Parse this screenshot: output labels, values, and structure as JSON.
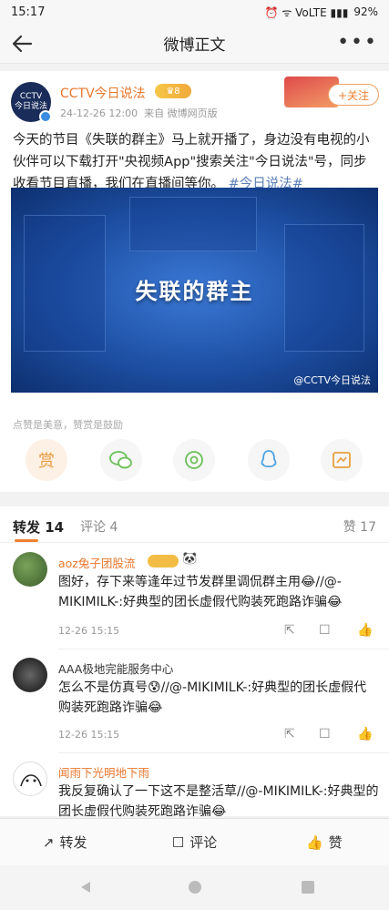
{
  "status_bar": {
    "time": "15:17",
    "icons_text": "⏰ ᯤ VoLTE ▮▮▮",
    "battery": "92%"
  },
  "nav": {
    "title": "微博正文"
  },
  "post": {
    "author": "CCTV今日说法",
    "avatar_text": "CCTV\n今日说法",
    "vip_label": "8",
    "time": "24-12-26 12:00",
    "source": "来自 微博网页版",
    "follow_label": "+关注",
    "text": "今天的节目《失联的群主》马上就开播了，身边没有电视的小伙伴可以下载打开\"央视频App\"搜索关注\"今日说法\"号，同步收看节目直播，我们在直播间等你。",
    "hashtag": "#今日说法#",
    "video_title": "失联的群主",
    "video_watermark": "@CCTV今日说法",
    "appreciation_hint": "点赞是美意，赞赏是鼓励",
    "share_icons": [
      "reward-icon",
      "wechat-icon",
      "moments-icon",
      "qq-icon",
      "save-image-icon"
    ],
    "reward_label": "赏"
  },
  "tabs": {
    "repost": "转发 14",
    "comment": "评论 4",
    "like": "赞 17"
  },
  "comments": [
    {
      "name": "aoz兔子团股流",
      "name_color": "#e8772d",
      "text": "图好，存下来等逢年过节发群里调侃群主用😂//@-MIKIMILK-:好典型的团长虚假代购装死跑路诈骗😂",
      "time": "12-26 15:15"
    },
    {
      "name": "AAA极地完能服务中心",
      "name_color": "#333333",
      "text": "怎么不是仿真号😰//@-MIKIMILK-:好典型的团长虚假代购装死跑路诈骗😂",
      "time": "12-26 15:15"
    },
    {
      "name": "闻雨下光明地下雨",
      "name_color": "#e8772d",
      "text": "我反复确认了一下这不是整活草//@-MIKIMILK-:好典型的团长虚假代购装死跑路诈骗😂",
      "time": ""
    }
  ],
  "bottom_bar": {
    "repost": "转发",
    "comment": "评论",
    "like": "赞"
  }
}
